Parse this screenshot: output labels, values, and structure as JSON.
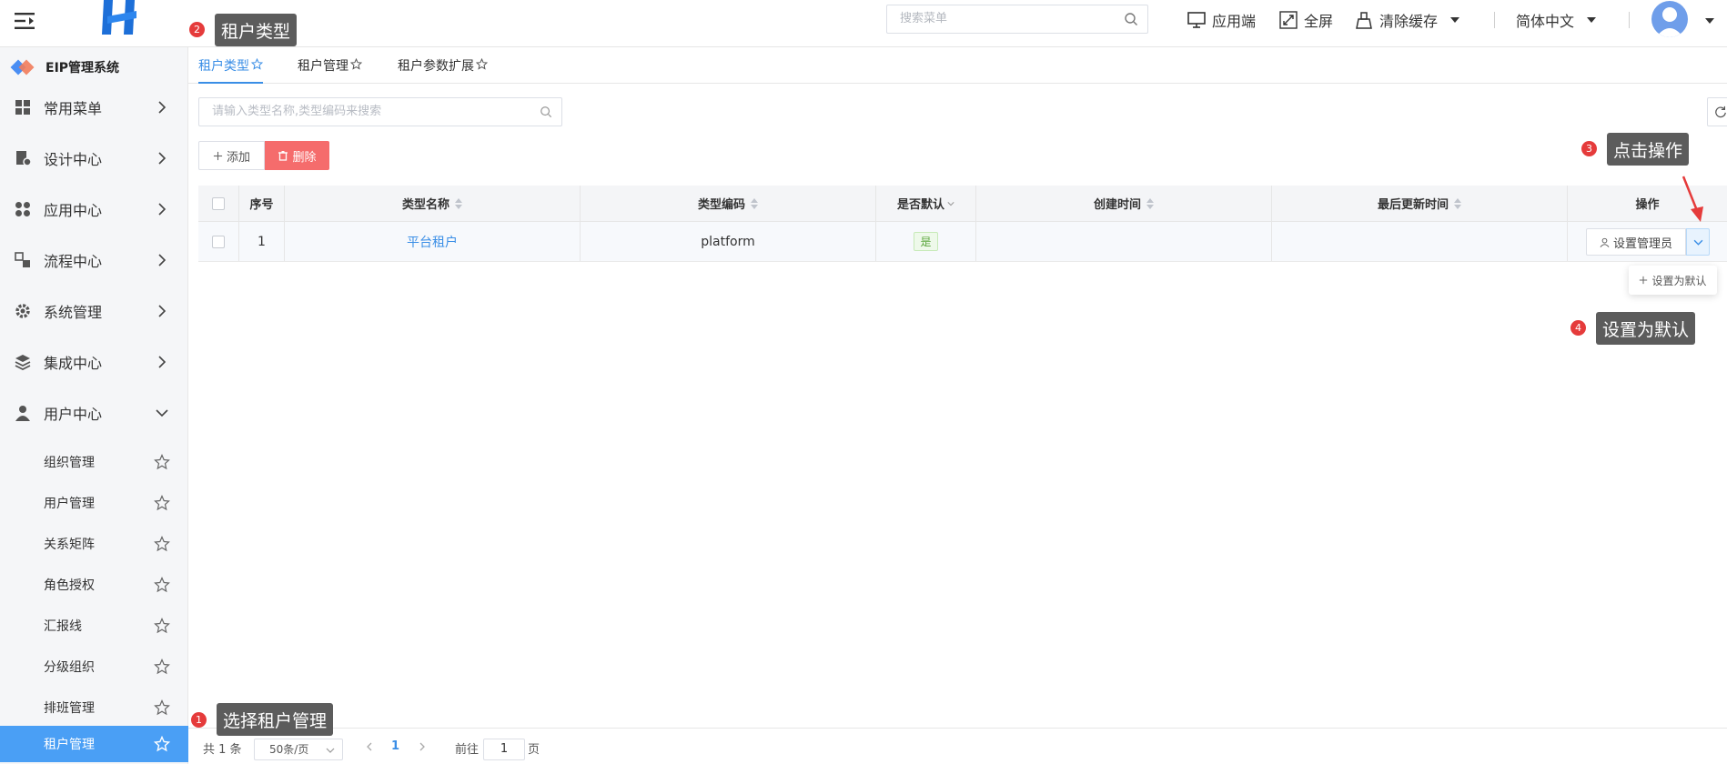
{
  "header": {
    "search_placeholder": "搜索菜单",
    "app_client": "应用端",
    "fullscreen": "全屏",
    "clear_cache": "清除缓存",
    "language": "简体中文"
  },
  "sidebar": {
    "brand": "EIP管理系统",
    "menus": [
      {
        "label": "常用菜单"
      },
      {
        "label": "设计中心"
      },
      {
        "label": "应用中心"
      },
      {
        "label": "流程中心"
      },
      {
        "label": "系统管理"
      },
      {
        "label": "集成中心"
      },
      {
        "label": "用户中心"
      }
    ],
    "sub_items": [
      {
        "label": "组织管理"
      },
      {
        "label": "用户管理"
      },
      {
        "label": "关系矩阵"
      },
      {
        "label": "角色授权"
      },
      {
        "label": "汇报线"
      },
      {
        "label": "分级组织"
      },
      {
        "label": "排班管理"
      },
      {
        "label": "租户管理"
      }
    ]
  },
  "tabs": [
    {
      "label": "租户类型"
    },
    {
      "label": "租户管理"
    },
    {
      "label": "租户参数扩展"
    }
  ],
  "toolbar": {
    "filter_placeholder": "请输入类型名称,类型编码来搜索",
    "add_label": "添加",
    "delete_label": "删除"
  },
  "table": {
    "columns": [
      "序号",
      "类型名称",
      "类型编码",
      "是否默认",
      "创建时间",
      "最后更新时间",
      "操作"
    ],
    "rows": [
      {
        "index": "1",
        "name": "平台租户",
        "code": "platform",
        "default": "是",
        "created": "",
        "updated": ""
      }
    ],
    "op_button": "设置管理员",
    "dropdown_item": "设置为默认"
  },
  "pagination": {
    "total": "共 1 条",
    "page_size": "50条/页",
    "current": "1",
    "goto_prefix": "前往",
    "goto_value": "1",
    "goto_suffix": "页"
  },
  "annotations": [
    {
      "num": "1",
      "text": "选择租户管理"
    },
    {
      "num": "2",
      "text": "租户类型"
    },
    {
      "num": "3",
      "text": "点击操作"
    },
    {
      "num": "4",
      "text": "设置为默认"
    }
  ],
  "colors": {
    "primary": "#3a8ee6",
    "danger": "#f56c6c",
    "active_menu": "#4a9ff5",
    "callout": "#5c5c5c",
    "badge": "#e53b3b"
  }
}
